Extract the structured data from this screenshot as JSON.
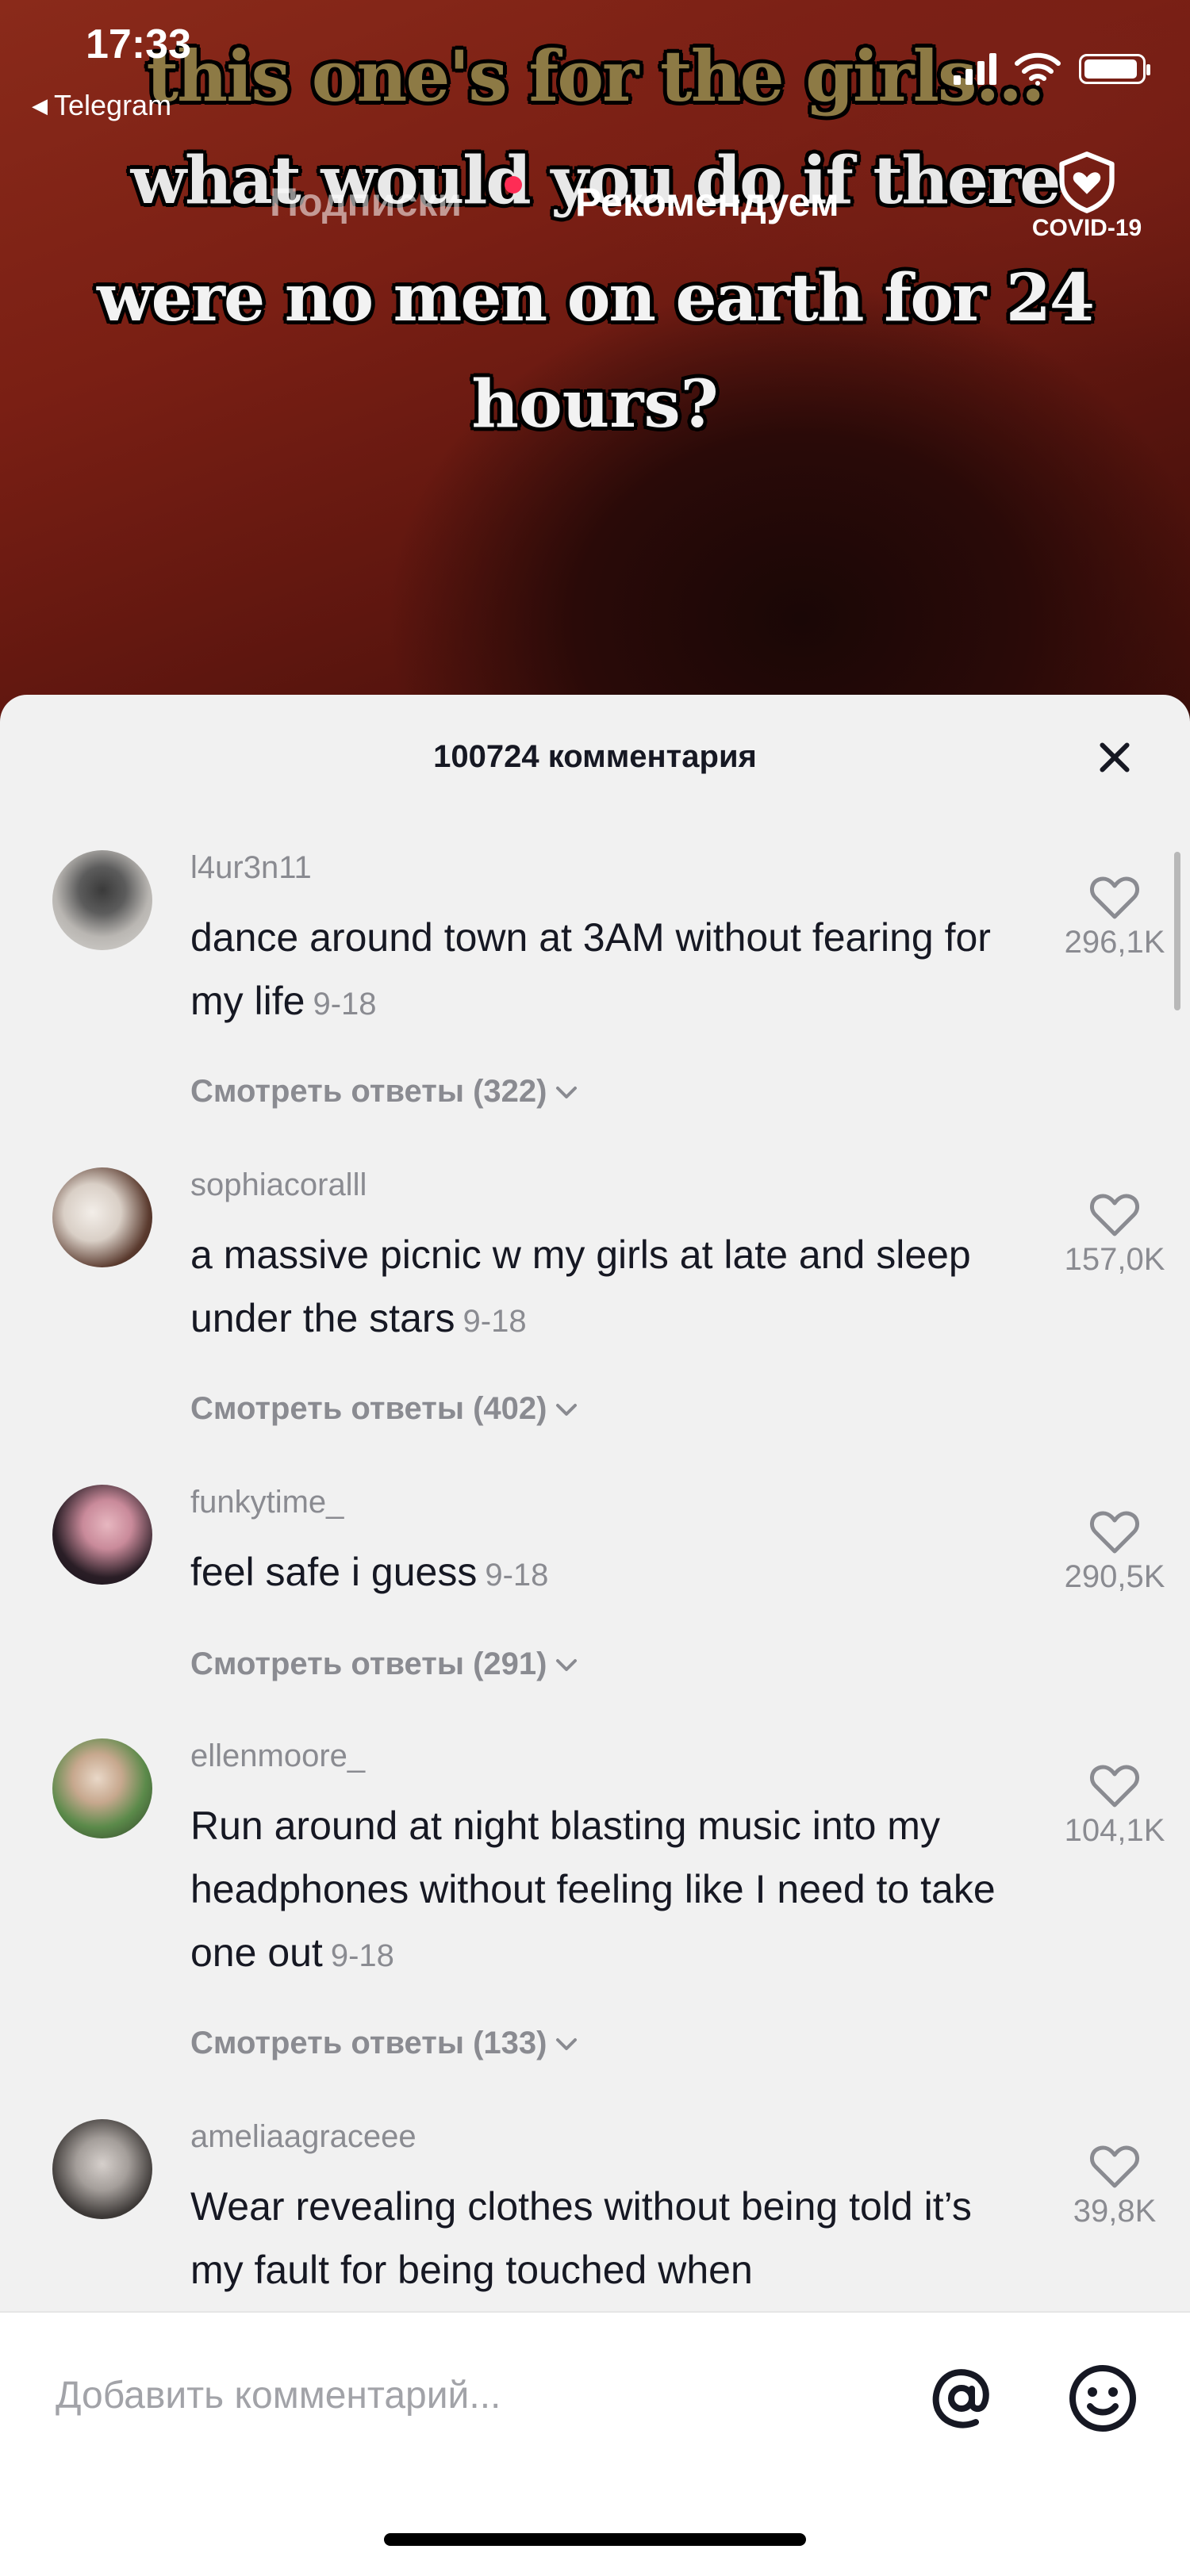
{
  "status_bar": {
    "time": "17:33",
    "back_app": "Telegram"
  },
  "video": {
    "caption_lines": [
      "this one's for the girls...",
      "what would you do if there",
      "were no men on earth for 24",
      "hours?"
    ],
    "tabs": {
      "following": "Подписки",
      "recommended": "Рекомендуем"
    },
    "covid_badge": "COVID-19"
  },
  "comments_sheet": {
    "title": "100724 комментария",
    "comments": [
      {
        "username": "l4ur3n11",
        "text": "dance around town at 3AM without fearing for my life",
        "date": "9-18",
        "likes": "296,1K",
        "replies": "Смотреть ответы (322)"
      },
      {
        "username": "sophiacoralll",
        "text": "a massive picnic w my girls at late and sleep under the stars",
        "date": "9-18",
        "likes": "157,0K",
        "replies": "Смотреть ответы (402)"
      },
      {
        "username": "funkytime_",
        "text": "feel safe i guess",
        "date": "9-18",
        "likes": "290,5K",
        "replies": "Смотреть ответы (291)"
      },
      {
        "username": "ellenmoore_",
        "text": "Run around at night blasting music into my headphones without feeling like I need to take one out",
        "date": "9-18",
        "likes": "104,1K",
        "replies": "Смотреть ответы (133)"
      },
      {
        "username": "ameliaagraceee",
        "text": "Wear revealing clothes without being told it’s my fault for being touched when",
        "date": "",
        "likes": "39,8K",
        "replies": ""
      }
    ]
  },
  "input": {
    "placeholder": "Добавить комментарий..."
  },
  "icons": {
    "close": "close-icon",
    "heart": "heart-outline-icon",
    "chevron": "chevron-down-icon",
    "mention": "at-icon",
    "emoji": "smiley-icon",
    "covid": "shield-heart-icon"
  },
  "colors": {
    "sheet_bg": "#f1f1f1",
    "text_primary": "#161823",
    "text_secondary": "#8a8b91",
    "live_dot": "#fe2c55"
  }
}
